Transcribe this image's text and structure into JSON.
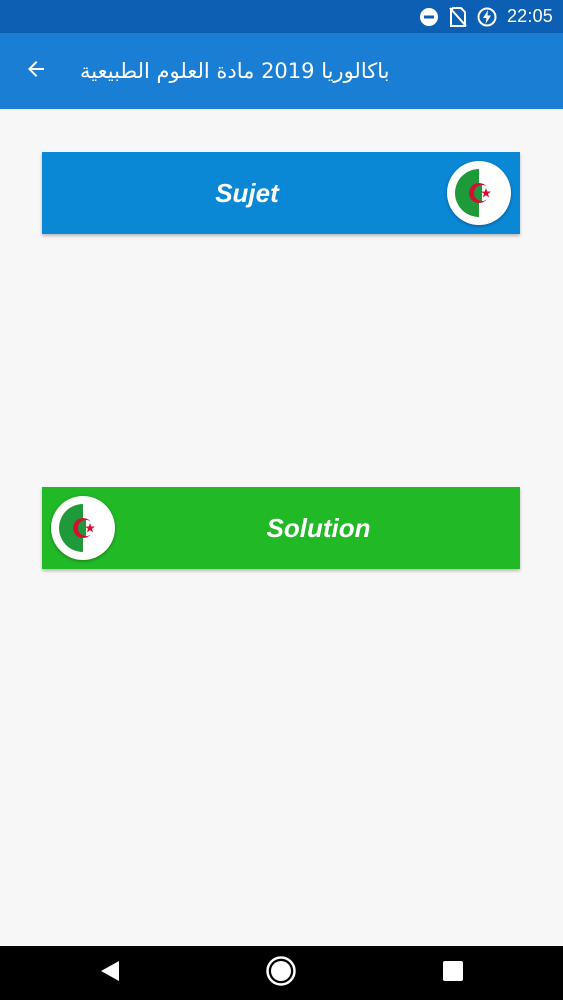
{
  "status_bar": {
    "time": "22:05",
    "icons": [
      "do-not-disturb-icon",
      "no-sim-icon",
      "battery-charging-icon"
    ]
  },
  "app_bar": {
    "title": "باكالوريا 2019 مادة العلوم الطبيعية",
    "back_icon": "arrow-back-icon"
  },
  "buttons": {
    "sujet": {
      "label": "Sujet",
      "color": "#0a88d6",
      "icon": "algeria-flag-icon"
    },
    "solution": {
      "label": "Solution",
      "color": "#22b926",
      "icon": "algeria-flag-icon"
    }
  },
  "nav_bar": {
    "icons": [
      "nav-back-icon",
      "nav-home-icon",
      "nav-recents-icon"
    ]
  },
  "colors": {
    "status_bar": "#0d5fb4",
    "app_bar": "#1a7fd4",
    "background": "#f7f7f7"
  }
}
